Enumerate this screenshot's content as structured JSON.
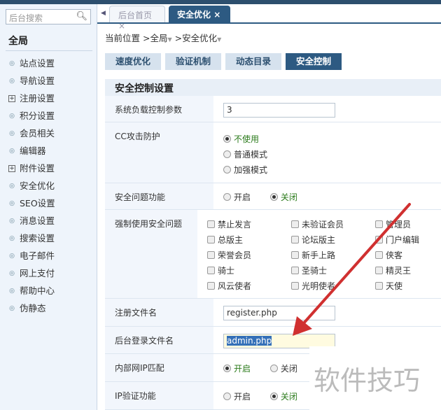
{
  "sidebar": {
    "search_placeholder": "后台搜索",
    "title": "全局",
    "items": [
      {
        "label": "站点设置",
        "type": "bullet"
      },
      {
        "label": "导航设置",
        "type": "bullet"
      },
      {
        "label": "注册设置",
        "type": "plus"
      },
      {
        "label": "积分设置",
        "type": "bullet"
      },
      {
        "label": "会员相关",
        "type": "bullet"
      },
      {
        "label": "编辑器",
        "type": "bullet"
      },
      {
        "label": "附件设置",
        "type": "plus"
      },
      {
        "label": "安全优化",
        "type": "bullet"
      },
      {
        "label": "SEO设置",
        "type": "bullet"
      },
      {
        "label": "消息设置",
        "type": "bullet"
      },
      {
        "label": "搜索设置",
        "type": "bullet"
      },
      {
        "label": "电子邮件",
        "type": "bullet"
      },
      {
        "label": "网上支付",
        "type": "bullet"
      },
      {
        "label": "帮助中心",
        "type": "bullet"
      },
      {
        "label": "伪静态",
        "type": "bullet"
      }
    ]
  },
  "tabs": [
    {
      "label": "后台首页"
    },
    {
      "label": "安全优化"
    }
  ],
  "close_glyph": "×",
  "breadcrumb": {
    "prefix": "当前位置",
    "sep": ">",
    "items": [
      "全局",
      "安全优化"
    ],
    "dropdown": "▼"
  },
  "subtabs": [
    "速度优化",
    "验证机制",
    "动态目录",
    "安全控制"
  ],
  "section_title": "安全控制设置",
  "form": {
    "load": {
      "label": "系统负载控制参数",
      "value": "3"
    },
    "cc": {
      "label": "CC攻击防护",
      "options": [
        "不使用",
        "普通模式",
        "加强模式"
      ]
    },
    "secq": {
      "label": "安全问题功能",
      "options": [
        "开启",
        "关闭"
      ]
    },
    "force": {
      "label": "强制使用安全问题",
      "options": [
        "禁止发言",
        "未验证会员",
        "管理员",
        "总版主",
        "论坛版主",
        "门户编辑",
        "荣誉会员",
        "新手上路",
        "侠客",
        "骑士",
        "圣骑士",
        "精灵王",
        "风云使者",
        "光明使者",
        "天使"
      ]
    },
    "register": {
      "label": "注册文件名",
      "value": "register.php"
    },
    "admin": {
      "label": "后台登录文件名",
      "value": "admin.php"
    },
    "intranet": {
      "label": "内部网IP匹配",
      "options": [
        "开启",
        "关闭"
      ]
    },
    "ipverify": {
      "label": "IP验证功能",
      "options": [
        "开启",
        "关闭"
      ]
    }
  },
  "watermark": "软件技巧"
}
